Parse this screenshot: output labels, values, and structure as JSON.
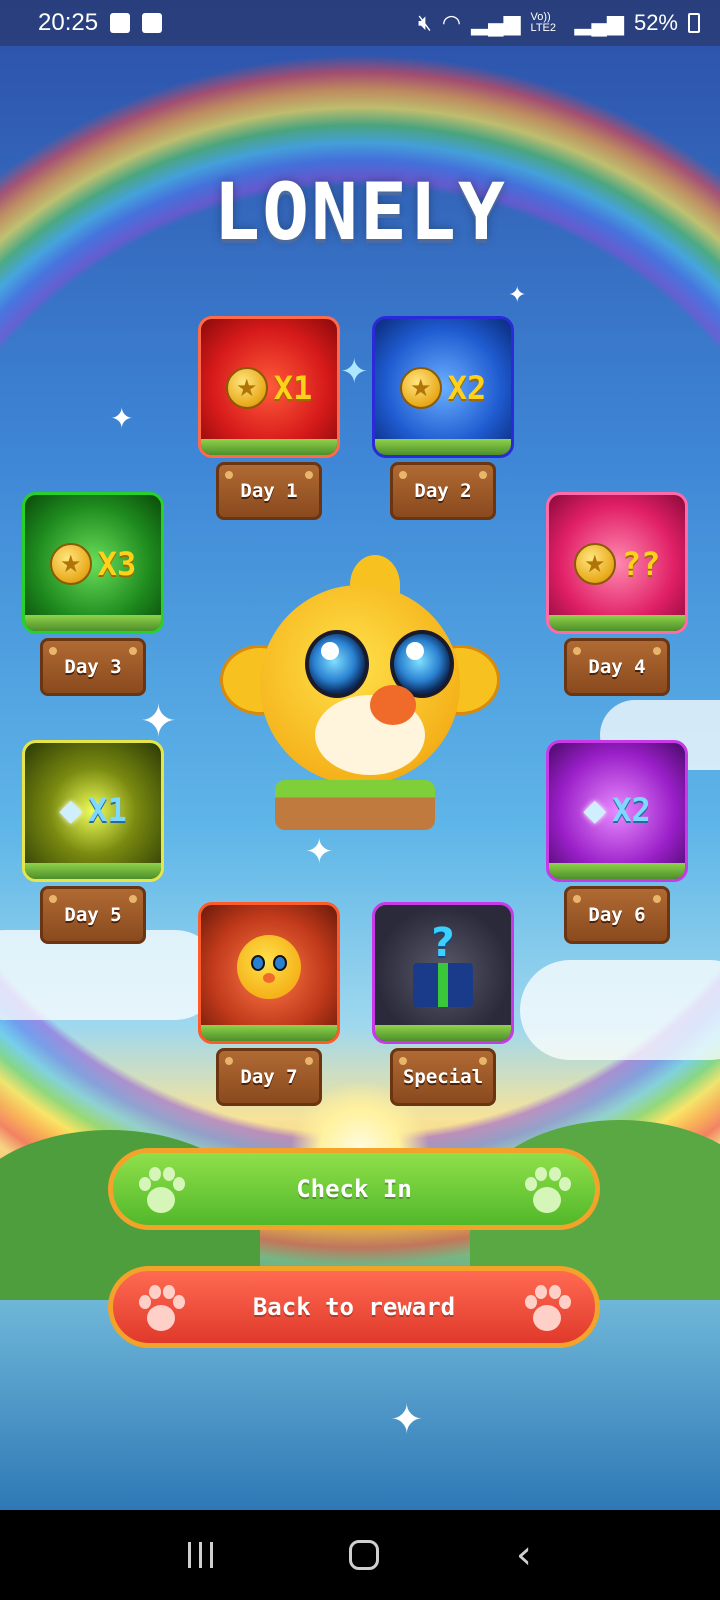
{
  "status_bar": {
    "time": "20:25",
    "battery": "52%",
    "icons": [
      "image-icon",
      "check-icon",
      "mute-icon",
      "wifi-icon",
      "signal-icon",
      "volte-icon",
      "signal-icon",
      "battery-icon"
    ],
    "volte_label": "Vo)) LTE2"
  },
  "title": "LONELY",
  "rewards": [
    {
      "day_label": "Day 1",
      "reward": "coin",
      "multiplier": "X1",
      "tile_color": "#d61a1a"
    },
    {
      "day_label": "Day 2",
      "reward": "coin",
      "multiplier": "X2",
      "tile_color": "#1f5bd0"
    },
    {
      "day_label": "Day 3",
      "reward": "coin",
      "multiplier": "X3",
      "tile_color": "#1e8a1e"
    },
    {
      "day_label": "Day 4",
      "reward": "coin",
      "multiplier": "??",
      "tile_color": "#e01f66"
    },
    {
      "day_label": "Day 5",
      "reward": "diamond",
      "multiplier": "X1",
      "tile_color": "#4a5a10"
    },
    {
      "day_label": "Day 6",
      "reward": "diamond",
      "multiplier": "X2",
      "tile_color": "#9a1fc8"
    },
    {
      "day_label": "Day 7",
      "reward": "chick",
      "multiplier": "",
      "tile_color": "#c0391a"
    },
    {
      "day_label": "Special",
      "reward": "mystery-gift",
      "multiplier": "",
      "tile_color": "#2a2a3a"
    }
  ],
  "buttons": {
    "check_in": "Check In",
    "back_to_reward": "Back to reward"
  },
  "colors": {
    "check_in_button": "#5ec22e",
    "back_button": "#ee4a36",
    "button_border": "#f3a32a"
  }
}
